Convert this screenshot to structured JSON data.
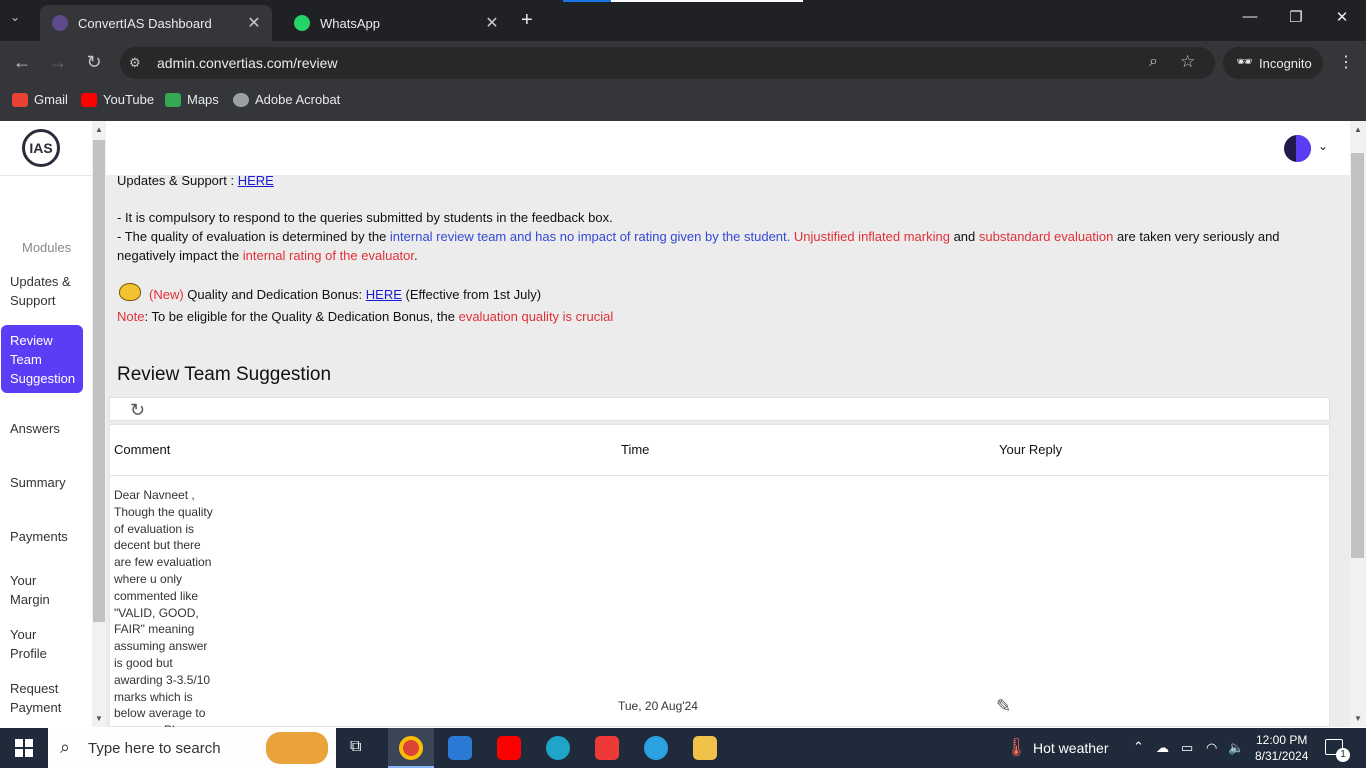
{
  "browser": {
    "tabs": [
      {
        "title": "ConvertIAS Dashboard"
      },
      {
        "title": "WhatsApp"
      }
    ],
    "url": "admin.convertias.com/review",
    "incognito_label": "Incognito",
    "bookmarks": [
      "Gmail",
      "YouTube",
      "Maps",
      "Adobe Acrobat"
    ]
  },
  "sidebar": {
    "logo_text": "IAS",
    "section_label": "Modules",
    "items": [
      {
        "label": "Updates & Support"
      },
      {
        "label": "Review Team Suggestion"
      },
      {
        "label": "Answers"
      },
      {
        "label": "Summary"
      },
      {
        "label": "Payments"
      },
      {
        "label": "Your Margin"
      },
      {
        "label": "Your Profile"
      },
      {
        "label": "Request Payment"
      }
    ],
    "active_color": "#5b3df5"
  },
  "content": {
    "updates_label": "Updates & Support : ",
    "updates_link": "HERE",
    "line1": "- It is compulsory to respond to the queries submitted by students in the feedback box.",
    "line2_a": "- The quality of evaluation is determined by the ",
    "line2_b": "internal review team and has no impact of rating given by the student.",
    "line2_c": " Unjustified inflated marking",
    "line2_d": " and ",
    "line2_e": "substandard evaluation",
    "line2_f": " are taken very seriously and",
    "line3_a": "negatively impact the ",
    "line3_b": "internal rating of the evaluator",
    "line3_c": ".",
    "bonus_new": "(New)",
    "bonus_text": " Quality and Dedication Bonus: ",
    "bonus_link": "HERE",
    "bonus_effective": "  (Effective from 1st July)",
    "note_label": "Note",
    "note_text": ":  To be eligible for the Quality & Dedication Bonus, the ",
    "note_red": "evaluation quality is crucial",
    "heading": "Review Team Suggestion",
    "table": {
      "headers": [
        "Comment",
        "Time",
        "Your Reply"
      ],
      "rows": [
        {
          "comment": "Dear Navneet , Though the quality of evaluation is decent but there are few evaluation where u only commented like \"VALID, GOOD, FAIR\" meaning assuming answer is good but awarding 3-3.5/10 marks which is below average to average. Please",
          "time": "Tue, 20 Aug'24"
        }
      ]
    }
  },
  "taskbar": {
    "search_placeholder": "Type here to search",
    "weather": "Hot weather",
    "time": "12:00 PM",
    "date": "8/31/2024",
    "notification_count": "1"
  }
}
